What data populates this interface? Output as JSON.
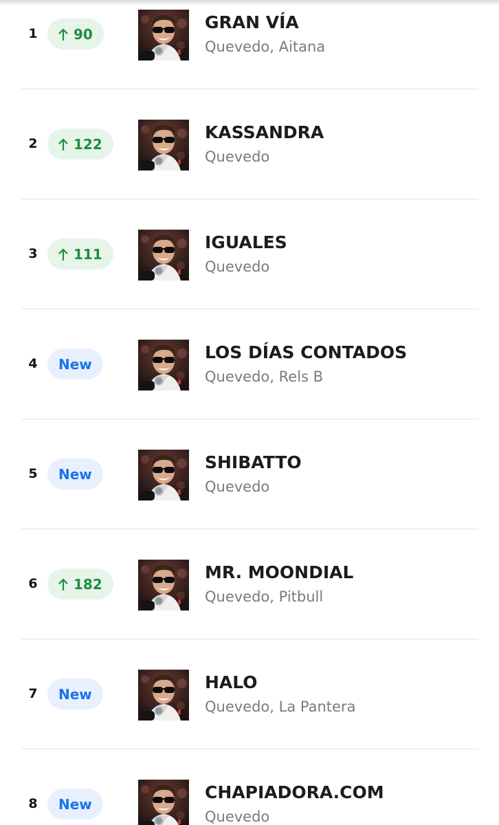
{
  "chart_entries": [
    {
      "rank": "1",
      "change_type": "up",
      "change": "90",
      "title": "GRAN VÍA",
      "artists": "Quevedo, Aitana"
    },
    {
      "rank": "2",
      "change_type": "up",
      "change": "122",
      "title": "KASSANDRA",
      "artists": "Quevedo"
    },
    {
      "rank": "3",
      "change_type": "up",
      "change": "111",
      "title": "IGUALES",
      "artists": "Quevedo"
    },
    {
      "rank": "4",
      "change_type": "new",
      "change": "New",
      "title": "LOS DÍAS CONTADOS",
      "artists": "Quevedo, Rels B"
    },
    {
      "rank": "5",
      "change_type": "new",
      "change": "New",
      "title": "SHIBATTO",
      "artists": "Quevedo"
    },
    {
      "rank": "6",
      "change_type": "up",
      "change": "182",
      "title": "MR. MOONDIAL",
      "artists": "Quevedo, Pitbull"
    },
    {
      "rank": "7",
      "change_type": "new",
      "change": "New",
      "title": "HALO",
      "artists": "Quevedo, La Pantera"
    },
    {
      "rank": "8",
      "change_type": "new",
      "change": "New",
      "title": "CHAPIADORA.COM",
      "artists": "Quevedo"
    }
  ],
  "icons": {
    "up": "arrow-up-icon",
    "cover": "album-cover-thumbnail"
  },
  "colors": {
    "up_text": "#1e8e3e",
    "up_bg": "#e6f4ea",
    "new_text": "#1a73e8",
    "new_bg": "#e8f0fe",
    "title_text": "#1c1c1c",
    "artist_text": "#7a7a7a",
    "divider": "#e2e2e2"
  }
}
